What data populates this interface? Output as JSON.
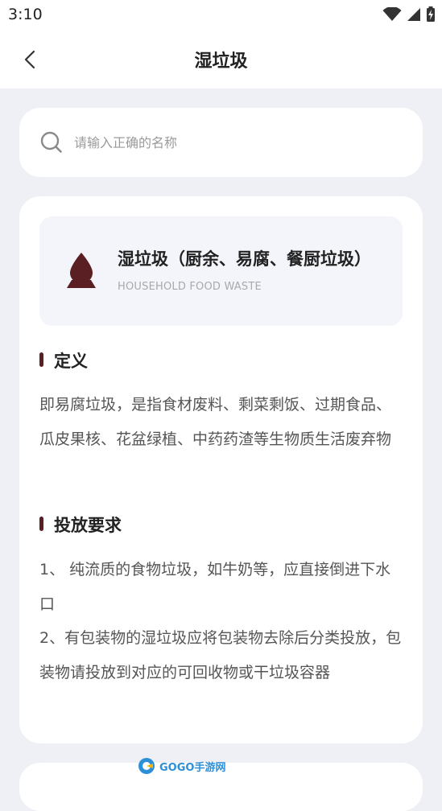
{
  "status": {
    "time": "3:10"
  },
  "appbar": {
    "title": "湿垃圾"
  },
  "search": {
    "placeholder": "请输入正确的名称"
  },
  "category": {
    "title": "湿垃圾（厨余、易腐、餐厨垃圾）",
    "subtitle": "HOUSEHOLD FOOD WASTE",
    "icon": "water-drop-icon",
    "color": "#5a1f22"
  },
  "sections": {
    "definition": {
      "title": "定义",
      "body": "即易腐垃圾，是指食材废料、剩菜剩饭、过期食品、瓜皮果核、花盆绿植、中药药渣等生物质生活废弃物"
    },
    "requirements": {
      "title": "投放要求",
      "body": "1、 纯流质的食物垃圾，如牛奶等，应直接倒进下水口\n2、有包装物的湿垃圾应将包装物去除后分类投放，包装物请投放到对应的可回收物或干垃圾容器"
    }
  },
  "watermark": {
    "brand": "GOGO手游网"
  }
}
